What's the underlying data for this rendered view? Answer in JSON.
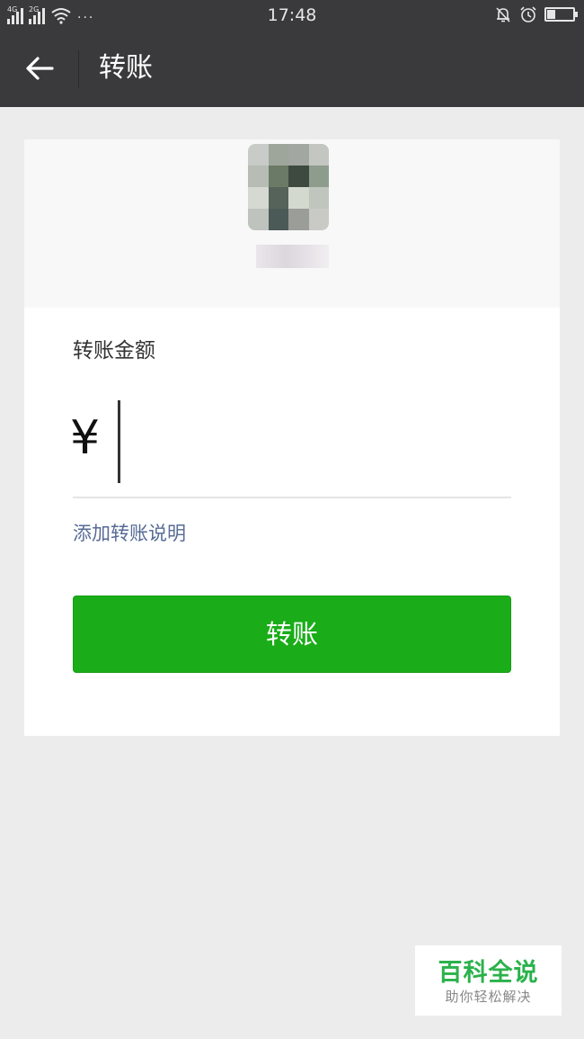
{
  "status_bar": {
    "signal_1_label": "4G",
    "signal_2_label": "2G",
    "more_dots": "···",
    "time": "17:48",
    "icons": [
      "signal-4g-icon",
      "signal-2g-icon",
      "wifi-icon",
      "mute-bell-icon",
      "alarm-clock-icon",
      "battery-icon"
    ]
  },
  "nav": {
    "back_icon": "arrow-left-icon",
    "title": "转账"
  },
  "recipient": {
    "avatar_pixels": [
      "#c9cbc8",
      "#9ea59b",
      "#a2a7a1",
      "#c3c6c1",
      "#b7bcb4",
      "#6b7a66",
      "#3e4a40",
      "#8e9c8d",
      "#d6d8d2",
      "#56635a",
      "#d4d9cf",
      "#c0c6bd",
      "#bfc3be",
      "#4c5a57",
      "#9a9d98",
      "#c9cac6"
    ]
  },
  "form": {
    "amount_label": "转账金额",
    "currency_symbol": "¥",
    "amount_value": "",
    "add_note_link": "添加转账说明",
    "submit_label": "转账"
  },
  "colors": {
    "accent_green": "#1aad19",
    "link_blue": "#576b95",
    "nav_bg": "#3a3a3c"
  },
  "watermark": {
    "title": "百科全说",
    "subtitle": "助你轻松解决"
  }
}
